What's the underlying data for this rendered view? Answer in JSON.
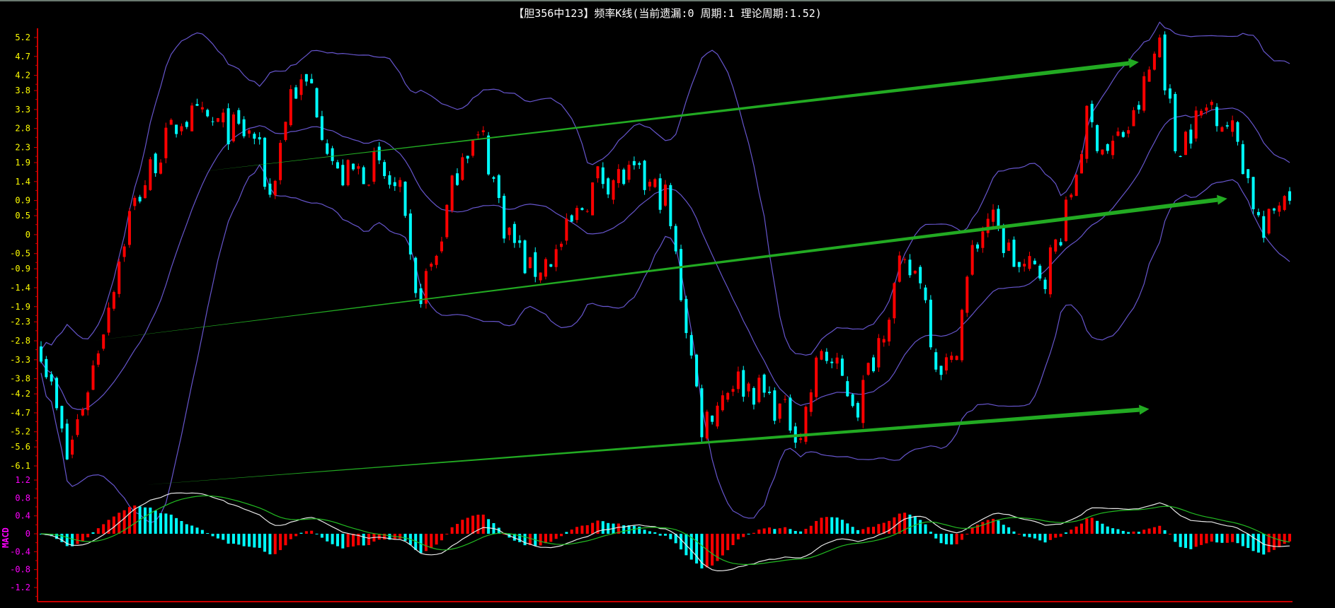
{
  "header": {
    "title": "【胆356中123】频率K线(当前遗漏:0 周期:1 理论周期:1.52)"
  },
  "colors": {
    "up": "#ff0000",
    "down": "#00ffff",
    "band": "#6655cc",
    "dif": "#e8e8e8",
    "dea": "#22bb22",
    "arrow": "#22aa22",
    "axis": "#cc0000",
    "price_label": "#ffff00",
    "macd_label": "#ff00ff"
  },
  "chart_data": [
    {
      "type": "candlestick",
      "title": "频率K线",
      "bars": 241,
      "ylim": [
        -6.1,
        5.2
      ],
      "yticks": [
        "5.2",
        "4.7",
        "4.2",
        "3.8",
        "3.3",
        "2.8",
        "2.3",
        "1.9",
        "1.4",
        "0.9",
        "0.5",
        "0",
        "-0.5",
        "-0.9",
        "-1.4",
        "-1.9",
        "-2.3",
        "-2.8",
        "-3.3",
        "-3.8",
        "-4.2",
        "-4.7",
        "-5.2",
        "-5.6",
        "-6.1"
      ],
      "price_path": [
        [
          0,
          -2.9
        ],
        [
          5,
          -5.9
        ],
        [
          10,
          -3.5
        ],
        [
          17,
          0.5
        ],
        [
          22,
          2.0
        ],
        [
          27,
          3.1
        ],
        [
          31,
          3.0
        ],
        [
          41,
          2.6
        ],
        [
          44,
          1.0
        ],
        [
          48,
          3.8
        ],
        [
          52,
          3.9
        ],
        [
          57,
          1.5
        ],
        [
          64,
          1.8
        ],
        [
          69,
          1.0
        ],
        [
          72,
          -1.8
        ],
        [
          76,
          -0.5
        ],
        [
          81,
          2.3
        ],
        [
          85,
          2.5
        ],
        [
          89,
          0.3
        ],
        [
          94,
          -1.0
        ],
        [
          99,
          -0.5
        ],
        [
          107,
          1.5
        ],
        [
          114,
          1.5
        ],
        [
          120,
          1.0
        ],
        [
          123,
          -1.5
        ],
        [
          127,
          -5.0
        ],
        [
          133,
          -3.8
        ],
        [
          139,
          -4.2
        ],
        [
          146,
          -5.2
        ],
        [
          150,
          -3.0
        ],
        [
          157,
          -4.5
        ],
        [
          165,
          -1.0
        ],
        [
          169,
          -1.0
        ],
        [
          172,
          -3.3
        ],
        [
          175,
          -3.5
        ],
        [
          179,
          -0.5
        ],
        [
          182,
          0.5
        ],
        [
          188,
          -0.9
        ],
        [
          193,
          -1.0
        ],
        [
          197,
          0.5
        ],
        [
          201,
          3.0
        ],
        [
          205,
          2.2
        ],
        [
          210,
          3.0
        ],
        [
          215,
          5.2
        ],
        [
          218,
          2.3
        ],
        [
          225,
          3.5
        ],
        [
          230,
          2.5
        ],
        [
          233,
          0.9
        ],
        [
          235,
          -0.1
        ],
        [
          238,
          1.0
        ],
        [
          240,
          1.3
        ]
      ],
      "indicators": [
        "Bollinger upper",
        "Bollinger middle",
        "Bollinger lower"
      ],
      "annotations": [
        {
          "type": "arrow",
          "from": [
            30,
            1.65
          ],
          "to": [
            211,
            4.55
          ]
        },
        {
          "type": "arrow",
          "from": [
            10,
            -2.8
          ],
          "to": [
            228,
            0.95
          ]
        },
        {
          "type": "arrow",
          "from": [
            20,
            -6.6
          ],
          "to": [
            213,
            -4.6
          ]
        }
      ]
    },
    {
      "type": "macd",
      "label": "MACD",
      "ylim": [
        -1.2,
        1.2
      ],
      "yticks": [
        "1.2",
        "0.8",
        "0.4",
        "0",
        "-0.4",
        "-0.8",
        "-1.2"
      ],
      "series": [
        "DIF",
        "DEA",
        "MACD histogram"
      ]
    }
  ]
}
